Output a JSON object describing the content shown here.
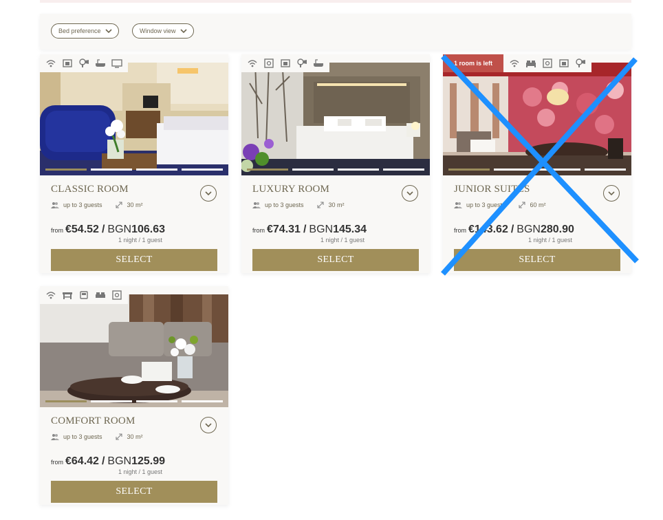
{
  "filters": [
    {
      "label": "Bed preference"
    },
    {
      "label": "Window view"
    }
  ],
  "rooms": [
    {
      "title": "CLASSIC ROOM",
      "guests": "up to 3 guests",
      "size": "30 m²",
      "from": "from",
      "eur_price": "€54.52",
      "slash": "/",
      "currency": "BGN",
      "bgn_price": "106.63",
      "per": "1 night / 1 guest",
      "select_label": "SELECT",
      "amenities": [
        "wifi-icon",
        "minibar-icon",
        "hairdryer-icon",
        "bathtub-icon",
        "tv-icon"
      ]
    },
    {
      "title": "LUXURY ROOM",
      "guests": "up to 3 guests",
      "size": "30 m²",
      "from": "from",
      "eur_price": "€74.31",
      "slash": "/",
      "currency": "BGN",
      "bgn_price": "145.34",
      "per": "1 night / 1 guest",
      "select_label": "SELECT",
      "amenities": [
        "wifi-icon",
        "safe-icon",
        "minibar-icon",
        "hairdryer-icon",
        "bathtub-icon"
      ]
    },
    {
      "title": "JUNIOR SUITES",
      "guests": "up to 3 guests",
      "size": "60 m²",
      "from": "from",
      "eur_price": "€143.62",
      "slash": "/",
      "currency": "BGN",
      "bgn_price": "280.90",
      "per": "1 night / 1 guest",
      "select_label": "SELECT",
      "badge": "1 room is left",
      "amenities": [
        "wifi-icon",
        "bed-icon",
        "safe-icon",
        "minibar-icon",
        "hairdryer-icon"
      ]
    },
    {
      "title": "COMFORT ROOM",
      "guests": "up to 3 guests",
      "size": "30 m²",
      "from": "from",
      "eur_price": "€64.42",
      "slash": "/",
      "currency": "BGN",
      "bgn_price": "125.99",
      "per": "1 night / 1 guest",
      "select_label": "SELECT",
      "amenities": [
        "wifi-icon",
        "desk-icon",
        "single-bed-icon",
        "double-bed-icon",
        "safe-icon"
      ]
    }
  ],
  "colors": {
    "accent": "#a18f5a",
    "text_olive": "#6d6650",
    "badge": "#c0504a",
    "cross_overlay": "#1e90ff"
  }
}
